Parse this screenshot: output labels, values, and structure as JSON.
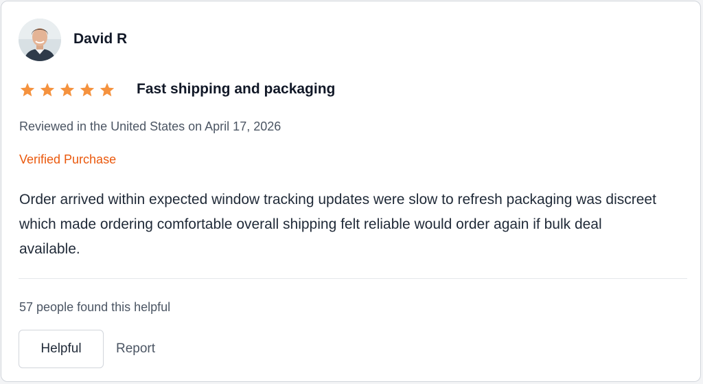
{
  "review": {
    "author": "David R",
    "rating": 5,
    "rating_max": 5,
    "title": "Fast shipping and packaging",
    "meta": "Reviewed in the United States on April 17, 2026",
    "verified_label": "Verified Purchase",
    "body": "Order arrived within expected window tracking updates were slow to refresh packaging was discreet which made ordering comfortable overall shipping felt reliable would order again if bulk deal available.",
    "helpful_count_text": "57 people found this helpful"
  },
  "actions": {
    "helpful_label": "Helpful",
    "report_label": "Report"
  },
  "colors": {
    "star": "#f5923e",
    "verified": "#ea580c",
    "border": "#d1d5db"
  },
  "icons": {
    "star": "star-icon",
    "avatar": "user-avatar-photo"
  }
}
